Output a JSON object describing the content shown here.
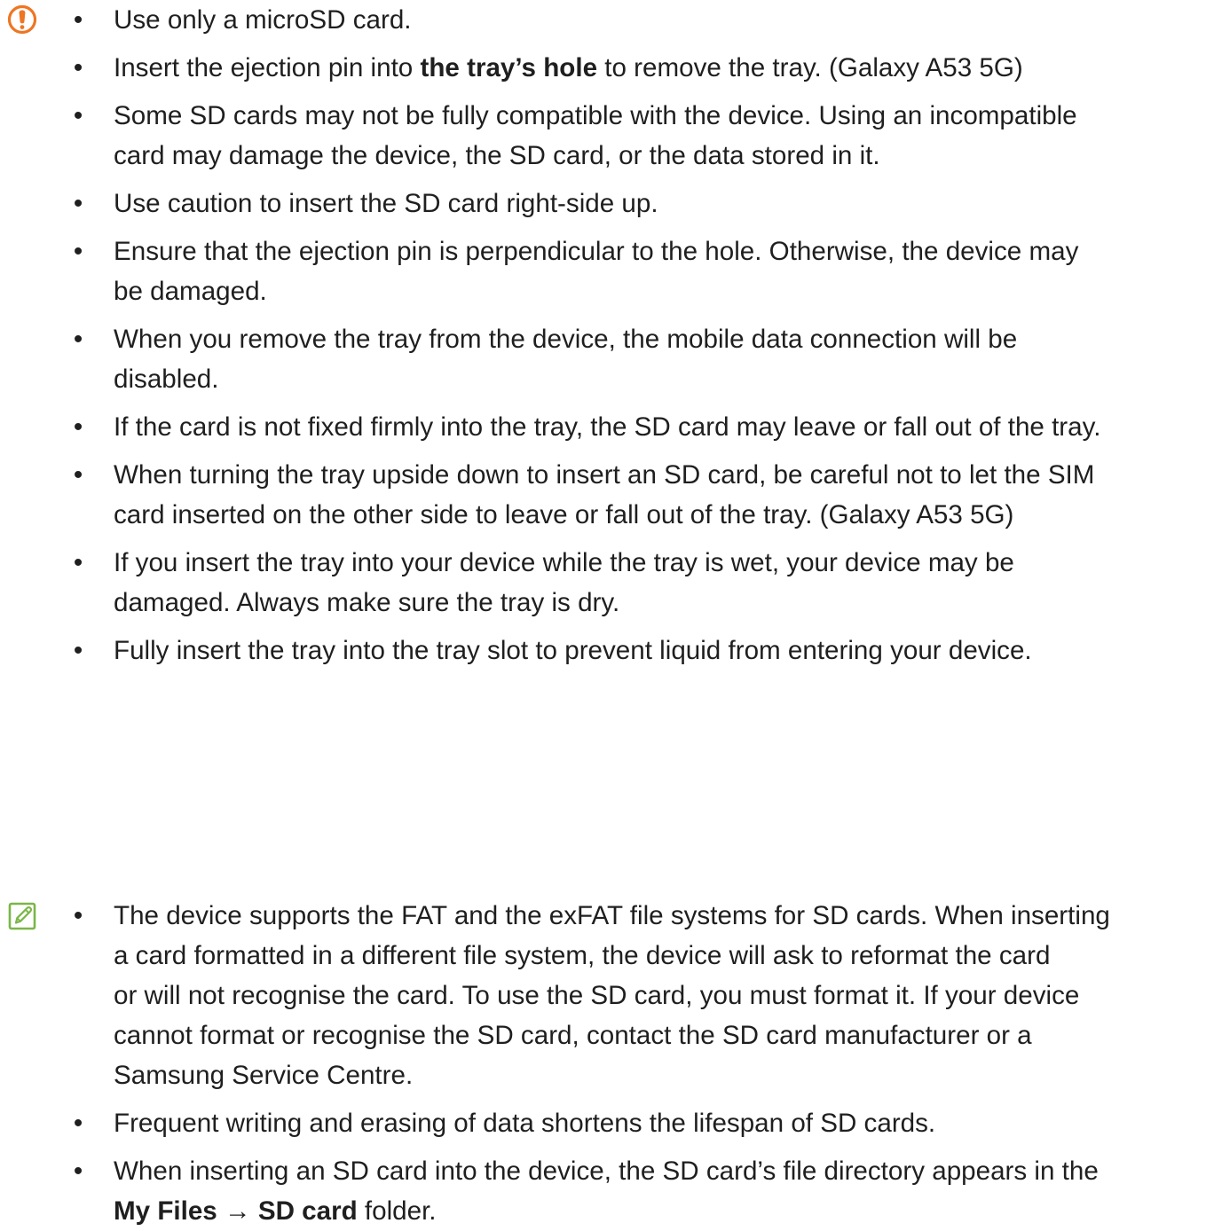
{
  "caution": {
    "icon": "caution-icon",
    "icon_color": "#ee7623",
    "items": [
      {
        "lines": [
          "Use only a microSD card."
        ]
      },
      {
        "prefix": "Insert the ejection pin into ",
        "bold": "the tray’s hole",
        "suffix": " to remove the tray. (Galaxy A53 5G)"
      },
      {
        "lines": [
          "Some SD cards may not be fully compatible with the device. Using an incompatible",
          "card may damage the device, the SD card, or the data stored in it."
        ]
      },
      {
        "lines": [
          "Use caution to insert the SD card right-side up."
        ]
      },
      {
        "lines": [
          "Ensure that the ejection pin is perpendicular to the hole. Otherwise, the device may",
          "be damaged."
        ]
      },
      {
        "lines": [
          "When you remove the tray from the device, the mobile data connection will be",
          "disabled."
        ]
      },
      {
        "lines": [
          "If the card is not fixed firmly into the tray, the SD card may leave or fall out of the tray."
        ]
      },
      {
        "lines": [
          "When turning the tray upside down to insert an SD card, be careful not to let the SIM",
          "card inserted on the other side to leave or fall out of the tray. (Galaxy A53 5G)"
        ]
      },
      {
        "lines": [
          "If you insert the tray into your device while the tray is wet, your device may be",
          "damaged. Always make sure the tray is dry."
        ]
      },
      {
        "lines": [
          "Fully insert the tray into the tray slot to prevent liquid from entering your device."
        ]
      }
    ]
  },
  "note": {
    "icon": "note-pencil-icon",
    "icon_color": "#7ab648",
    "items": [
      {
        "lines": [
          "The device supports the FAT and the exFAT file systems for SD cards. When inserting",
          "a card formatted in a different file system, the device will ask to reformat the card",
          "or will not recognise the card. To use the SD card, you must format it. If your device",
          "cannot format or recognise the SD card, contact the SD card manufacturer or a",
          "Samsung Service Centre."
        ]
      },
      {
        "lines": [
          "Frequent writing and erasing of data shortens the lifespan of SD cards."
        ]
      },
      {
        "line1": "When inserting an SD card into the device, the SD card’s file directory appears in the",
        "bold1": "My Files",
        "arrow": "→",
        "bold2": "SD card",
        "suffix": " folder."
      }
    ]
  },
  "bullet_char": "•"
}
